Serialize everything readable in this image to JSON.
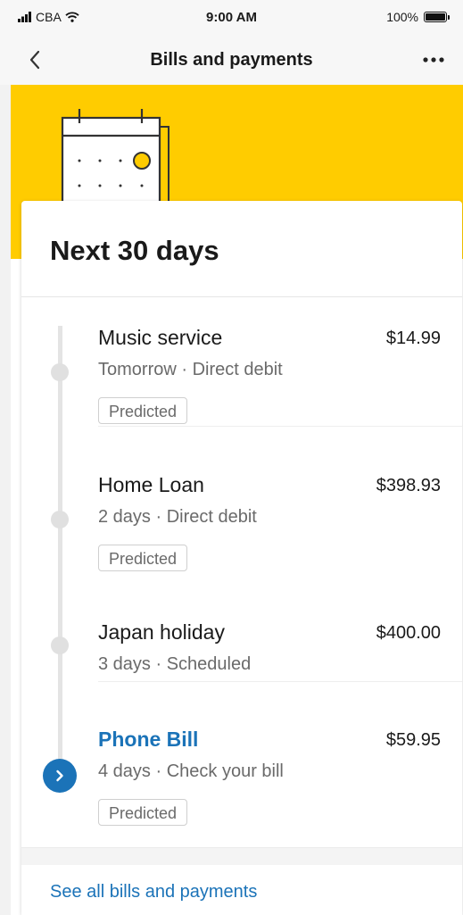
{
  "status_bar": {
    "carrier": "CBA",
    "time": "9:00 AM",
    "battery": "100%",
    "icons": [
      "signal-icon",
      "wifi-icon",
      "battery-icon"
    ]
  },
  "nav": {
    "title": "Bills and payments",
    "back_icon": "chevron-left-icon",
    "more_icon": "more-icon"
  },
  "colors": {
    "hero": "#ffcc00",
    "accent": "#1b73b8"
  },
  "card": {
    "title": "Next 30 days",
    "items": [
      {
        "name": "Music service",
        "amount": "$14.99",
        "meta": "Tomorrow · Direct debit",
        "tag": "Predicted"
      },
      {
        "name": "Home Loan",
        "amount": "$398.93",
        "meta": "2 days · Direct debit",
        "tag": "Predicted"
      },
      {
        "name": "Japan holiday",
        "amount": "$400.00",
        "meta": "3 days · Scheduled"
      },
      {
        "name": "Phone Bill",
        "amount": "$59.95",
        "meta": "4 days · Check your bill",
        "tag": "Predicted"
      }
    ],
    "see_all": "See all bills and payments"
  }
}
